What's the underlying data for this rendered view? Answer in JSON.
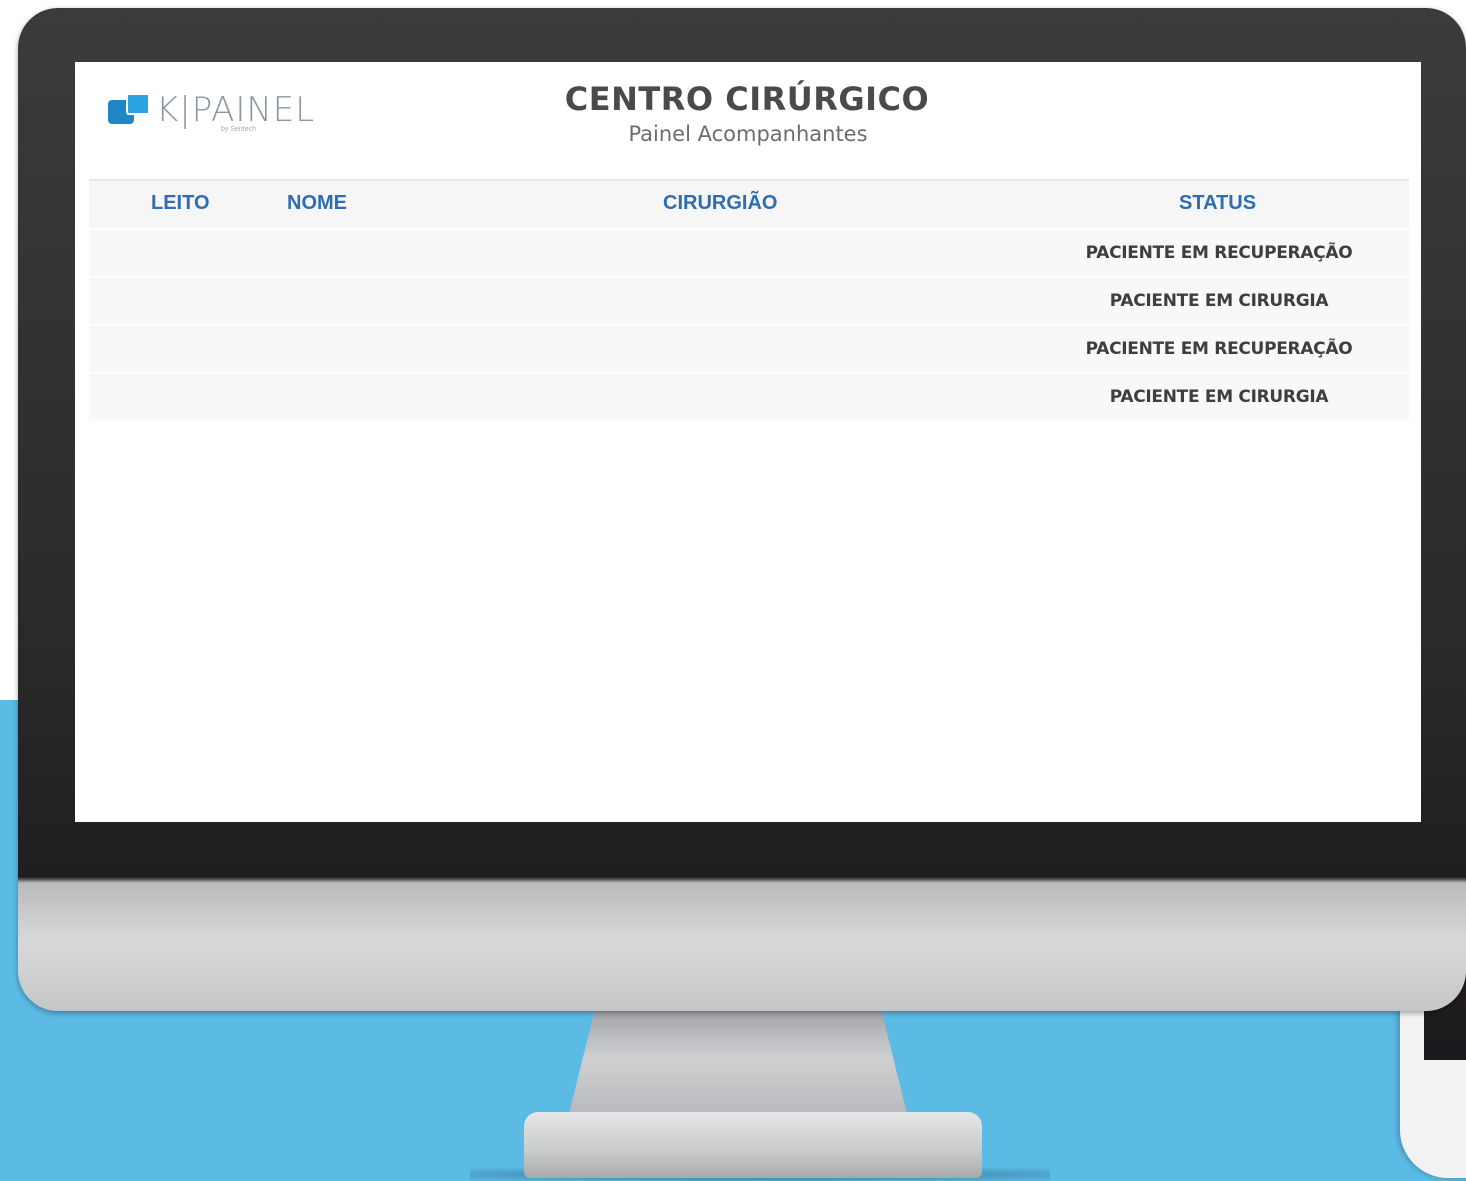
{
  "app": {
    "logo_text": "K|PAINEL",
    "logo_sub": "by Sentech",
    "title": "CENTRO CIRÚRGICO",
    "subtitle": "Painel Acompanhantes"
  },
  "table": {
    "headers": [
      "LEITO",
      "NOME",
      "CIRURGIÃO",
      "STATUS"
    ],
    "rows": [
      {
        "leito": "",
        "nome": "",
        "cirurgiao": "",
        "status": "PACIENTE EM RECUPERAÇÃO"
      },
      {
        "leito": "",
        "nome": "",
        "cirurgiao": "",
        "status": "PACIENTE EM CIRURGIA"
      },
      {
        "leito": "",
        "nome": "",
        "cirurgiao": "",
        "status": "PACIENTE EM RECUPERAÇÃO"
      },
      {
        "leito": "",
        "nome": "",
        "cirurgiao": "",
        "status": "PACIENTE EM CIRURGIA"
      }
    ]
  },
  "phone": {
    "status_dots": "●●○○"
  },
  "colors": {
    "header_text": "#2f6db0",
    "backdrop": "#5bbbe5",
    "logo_blue": "#1f86c6"
  }
}
